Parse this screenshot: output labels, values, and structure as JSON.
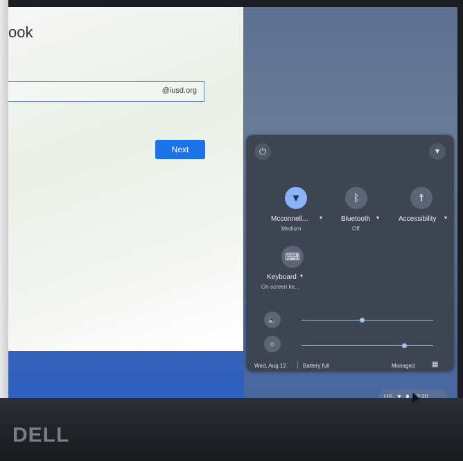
{
  "login": {
    "title_partial": "ook",
    "email_suffix": "@iusd.org",
    "next_label": "Next"
  },
  "quick_settings": {
    "tiles": [
      {
        "label": "Mcconnell...",
        "sublabel": "Medium",
        "icon": "wifi-icon",
        "active": true
      },
      {
        "label": "Bluetooth",
        "sublabel": "Off",
        "icon": "bluetooth-icon",
        "active": false
      },
      {
        "label": "Accessibility",
        "sublabel": "",
        "icon": "accessibility-icon",
        "active": false
      },
      {
        "label": "Keyboard",
        "sublabel": "On-screen ke...",
        "icon": "keyboard-icon",
        "active": false
      }
    ],
    "volume_level": 0.46,
    "brightness_level": 0.78,
    "date": "Wed, Aug 12",
    "battery": "Battery full",
    "managed": "Managed"
  },
  "shelf": {
    "ime": "US",
    "time": "12:20"
  },
  "brand": "DELL",
  "colors": {
    "accent": "#1a73e8",
    "panel": "#3e4552",
    "active_tile": "#8ab4f8"
  }
}
